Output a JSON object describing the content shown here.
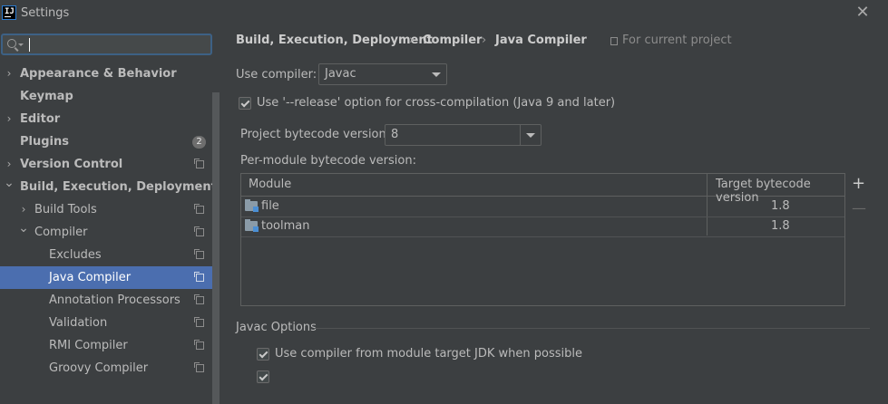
{
  "window": {
    "app_icon": "intellij-idea-icon",
    "app_icon_text": "IJ",
    "title": "Settings",
    "close_glyph": "✕"
  },
  "search": {
    "value": "",
    "placeholder": ""
  },
  "sidebar": {
    "items": [
      {
        "label": "Appearance & Behavior",
        "level": 0,
        "bold": true,
        "chevron": "right",
        "selected": false
      },
      {
        "label": "Keymap",
        "level": 0,
        "bold": true,
        "chevron": "",
        "selected": false
      },
      {
        "label": "Editor",
        "level": 0,
        "bold": true,
        "chevron": "right",
        "selected": false
      },
      {
        "label": "Plugins",
        "level": 0,
        "bold": true,
        "chevron": "",
        "badge": "2",
        "selected": false
      },
      {
        "label": "Version Control",
        "level": 0,
        "bold": true,
        "chevron": "right",
        "project_icon": true,
        "selected": false
      },
      {
        "label": "Build, Execution, Deployment",
        "level": 0,
        "bold": true,
        "chevron": "down",
        "selected": false
      },
      {
        "label": "Build Tools",
        "level": 1,
        "bold": false,
        "chevron": "right",
        "project_icon": true,
        "selected": false
      },
      {
        "label": "Compiler",
        "level": 1,
        "bold": false,
        "chevron": "down",
        "project_icon": true,
        "selected": false
      },
      {
        "label": "Excludes",
        "level": 2,
        "bold": false,
        "chevron": "",
        "project_icon": true,
        "selected": false
      },
      {
        "label": "Java Compiler",
        "level": 2,
        "bold": false,
        "chevron": "",
        "project_icon": true,
        "selected": true
      },
      {
        "label": "Annotation Processors",
        "level": 2,
        "bold": false,
        "chevron": "",
        "project_icon": true,
        "selected": false
      },
      {
        "label": "Validation",
        "level": 2,
        "bold": false,
        "chevron": "",
        "project_icon": true,
        "selected": false
      },
      {
        "label": "RMI Compiler",
        "level": 2,
        "bold": false,
        "chevron": "",
        "project_icon": true,
        "selected": false
      },
      {
        "label": "Groovy Compiler",
        "level": 2,
        "bold": false,
        "chevron": "",
        "project_icon": true,
        "selected": false
      }
    ]
  },
  "breadcrumb": {
    "items": [
      "Build, Execution, Deployment",
      "Compiler",
      "Java Compiler"
    ],
    "separator": "›",
    "scope_label": "For current project"
  },
  "compiler": {
    "use_compiler_label": "Use compiler:",
    "use_compiler_value": "Javac",
    "release_option_label": "Use '--release' option for cross-compilation (Java 9 and later)",
    "release_option_checked": true,
    "bytecode_label": "Project bytecode version:",
    "bytecode_value": "8",
    "per_module_label": "Per-module bytecode version:"
  },
  "module_table": {
    "columns": [
      "Module",
      "Target bytecode version"
    ],
    "rows": [
      {
        "module": "file",
        "target": "1.8"
      },
      {
        "module": "toolman",
        "target": "1.8"
      }
    ],
    "add_glyph": "+",
    "remove_glyph": "—"
  },
  "javac_options": {
    "section_label": "Javac Options",
    "use_module_jdk_label": "Use compiler from module target JDK when possible",
    "use_module_jdk_checked": true,
    "next_option_checked": true
  },
  "colors": {
    "background": "#3c3f41",
    "selection": "#4b6eaf",
    "focus_border": "#3d6185",
    "text": "#bbbbbb"
  }
}
